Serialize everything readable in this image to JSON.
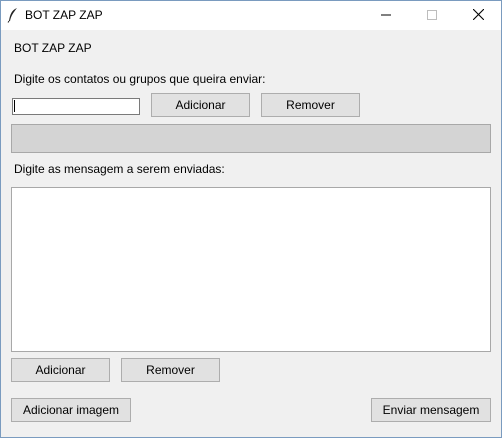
{
  "window": {
    "title": "BOT ZAP ZAP",
    "icon": "feather-icon",
    "controls": [
      "minimize-icon",
      "maximize-icon",
      "close-icon"
    ]
  },
  "app": {
    "header": "BOT ZAP ZAP",
    "contacts_prompt": "Digite os contatos ou grupos que queira enviar:",
    "contact_input_value": "",
    "add_contact_label": "Adicionar",
    "remove_contact_label": "Remover",
    "messages_prompt": "Digite as mensagem a serem enviadas:",
    "message_text_value": "",
    "add_message_label": "Adicionar",
    "remove_message_label": "Remover",
    "add_image_label": "Adicionar imagem",
    "send_label": "Enviar mensagem"
  }
}
